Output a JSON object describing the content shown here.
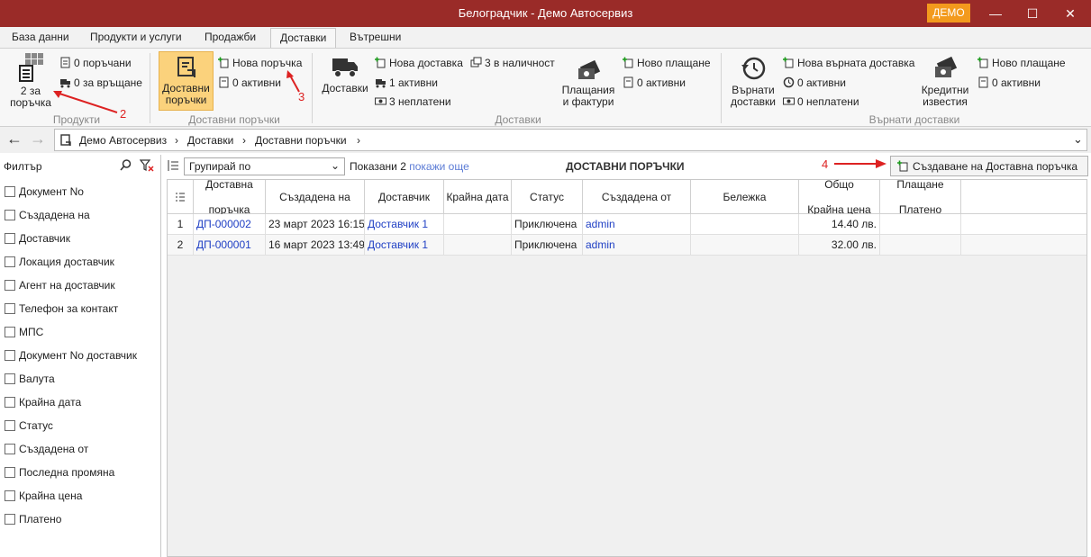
{
  "window": {
    "title": "Белоградчик - Демо Автосервиз",
    "badge": "ДЕМО",
    "minimize": "—",
    "maximize": "☐",
    "close": "✕"
  },
  "tabs": [
    "База данни",
    "Продукти и услуги",
    "Продажби",
    "Доставки",
    "Вътрешни"
  ],
  "ribbon": {
    "products": {
      "big_label_1": "2 за",
      "big_label_2": "поръчка",
      "ordered": "0 поръчани",
      "to_return": "0 за връщане",
      "group": "Продукти"
    },
    "delivery_orders": {
      "big_label_1": "Доставни",
      "big_label_2": "поръчки",
      "new": "Нова поръчка",
      "active": "0 активни",
      "group": "Доставни поръчки"
    },
    "deliveries": {
      "big_label": "Доставки",
      "new": "Нова доставка",
      "in_stock": "3 в наличност",
      "active": "1 активни",
      "unpaid": "3 неплатени",
      "payments_1": "Плащания",
      "payments_2": "и фактури",
      "new_payment": "Ново плащане",
      "payments_active": "0 активни",
      "group": "Доставки"
    },
    "returned": {
      "big_label_1": "Върнати",
      "big_label_2": "доставки",
      "new": "Нова върната доставка",
      "active": "0 активни",
      "unpaid": "0 неплатени",
      "credit_1": "Кредитни",
      "credit_2": "известия",
      "new_payment": "Ново плащане",
      "credit_active": "0 активни",
      "group": "Върнати доставки"
    }
  },
  "breadcrumb": [
    "Демо Автосервиз",
    "Доставки",
    "Доставни поръчки"
  ],
  "filter": {
    "label": "Филтър",
    "items": [
      "Документ No",
      "Създадена на",
      "Доставчик",
      "Локация доставчик",
      "Агент на доставчик",
      "Телефон за контакт",
      "МПС",
      "Документ No доставчик",
      "Валута",
      "Крайна дата",
      "Статус",
      "Създадена от",
      "Последна промяна",
      "Крайна цена",
      "Платено"
    ]
  },
  "toolbar": {
    "group_by": "Групирай по",
    "shown_prefix": "Показани",
    "shown_count": "2",
    "show_more": "покажи още",
    "view_title": "ДОСТАВНИ ПОРЪЧКИ",
    "create_button": "Създаване на Доставна поръчка"
  },
  "table": {
    "headers": [
      [
        "Доставна",
        "поръчка"
      ],
      [
        "Създадена на",
        ""
      ],
      [
        "Доставчик",
        ""
      ],
      [
        "Крайна дата",
        ""
      ],
      [
        "Статус",
        ""
      ],
      [
        "Създадена от",
        ""
      ],
      [
        "Бележка",
        ""
      ],
      [
        "Общо",
        "Крайна цена"
      ],
      [
        "Плащане",
        "Платено"
      ]
    ],
    "rows": [
      {
        "n": "1",
        "doc": "ДП-000002",
        "created": "23 март 2023 16:15",
        "supplier": "Доставчик 1",
        "due": "",
        "status": "Приключена",
        "by": "admin",
        "note": "",
        "total": "14.40 лв.",
        "paid": ""
      },
      {
        "n": "2",
        "doc": "ДП-000001",
        "created": "16 март 2023 13:49",
        "supplier": "Доставчик 1",
        "due": "",
        "status": "Приключена",
        "by": "admin",
        "note": "",
        "total": "32.00 лв.",
        "paid": ""
      }
    ]
  },
  "annotations": [
    "2",
    "3",
    "4"
  ]
}
